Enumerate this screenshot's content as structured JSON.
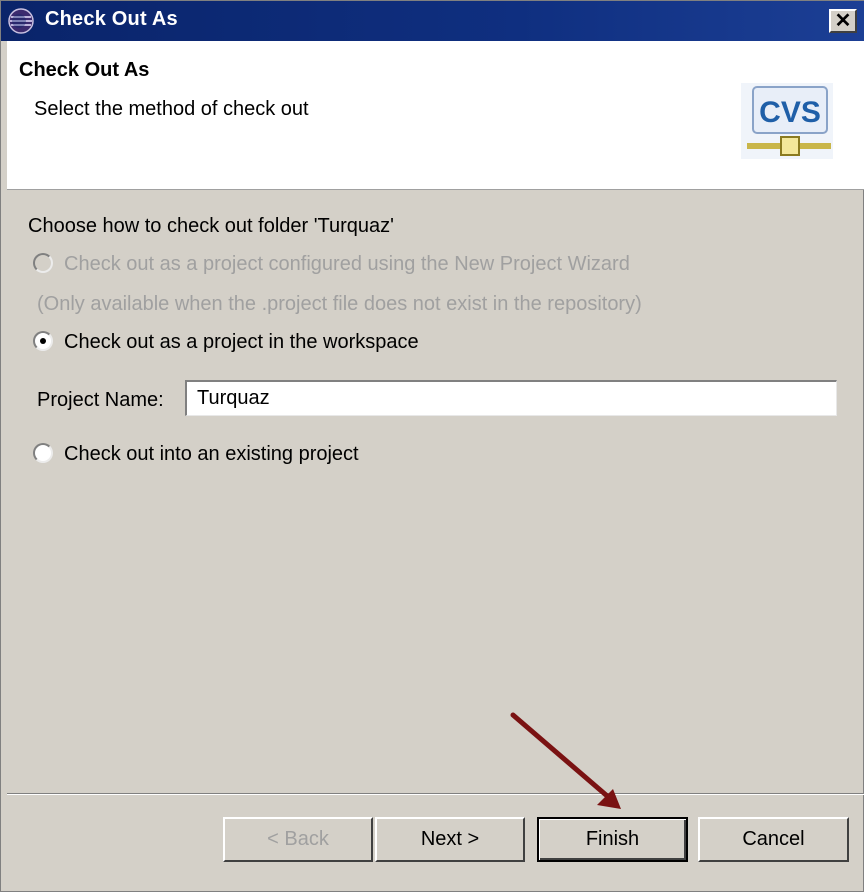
{
  "window": {
    "title": "Check Out As",
    "close_symbol": "✕",
    "app_icon": "eclipse-icon"
  },
  "banner": {
    "heading": "Check Out As",
    "description": "Select the method of check out",
    "logo_text": "CVS"
  },
  "content": {
    "prompt": "Choose how to check out folder 'Turquaz'",
    "options": [
      {
        "label": "Check out as a project configured using the New Project Wizard",
        "enabled": false,
        "selected": false
      },
      {
        "label": "Check out as a project in the workspace",
        "enabled": true,
        "selected": true
      },
      {
        "label": "Check out into an existing project",
        "enabled": true,
        "selected": false
      }
    ],
    "note": "(Only available when the .project file does not exist in the repository)",
    "project_name_label": "Project Name:",
    "project_name_value": "Turquaz"
  },
  "buttons": {
    "back": "< Back",
    "next": "Next >",
    "finish": "Finish",
    "cancel": "Cancel"
  },
  "colors": {
    "titlebar": "#0a246a",
    "dialog_bg": "#d4d0c8",
    "annotation_arrow": "#7a1212"
  }
}
